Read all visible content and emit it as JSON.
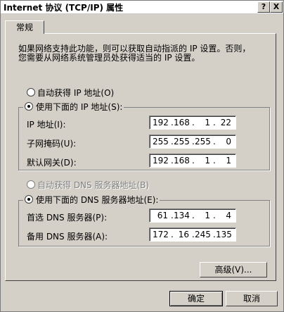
{
  "window": {
    "title": "Internet 协议 (TCP/IP) 属性",
    "help_glyph": "?",
    "close_glyph": "X"
  },
  "tab": {
    "label": "常规"
  },
  "intro": {
    "line1": "如果网络支持此功能，则可以获取自动指派的 IP 设置。否则，",
    "line2": "您需要从网络系统管理员处获得适当的 IP 设置。"
  },
  "ip_mode": {
    "auto_label": "自动获得 IP 地址(O)",
    "manual_label": "使用下面的 IP 地址(S):",
    "selected": "manual"
  },
  "ip_fields": [
    {
      "label": "IP 地址(I):",
      "octets": [
        "192",
        "168",
        "1",
        "22"
      ]
    },
    {
      "label": "子网掩码(U):",
      "octets": [
        "255",
        "255",
        "255",
        "0"
      ]
    },
    {
      "label": "默认网关(D):",
      "octets": [
        "192",
        "168",
        "1",
        "1"
      ]
    }
  ],
  "dns_mode": {
    "auto_label": "自动获得 DNS 服务器地址(B)",
    "manual_label": "使用下面的 DNS 服务器地址(E):",
    "selected": "manual"
  },
  "dns_fields": [
    {
      "label": "首选 DNS 服务器(P):",
      "octets": [
        "61",
        "134",
        "1",
        "4"
      ]
    },
    {
      "label": "备用 DNS 服务器(A):",
      "octets": [
        "172",
        "16",
        "245",
        "135"
      ]
    }
  ],
  "buttons": {
    "advanced": "高级(V)...",
    "ok": "确定",
    "cancel": "取消"
  },
  "dot": "."
}
